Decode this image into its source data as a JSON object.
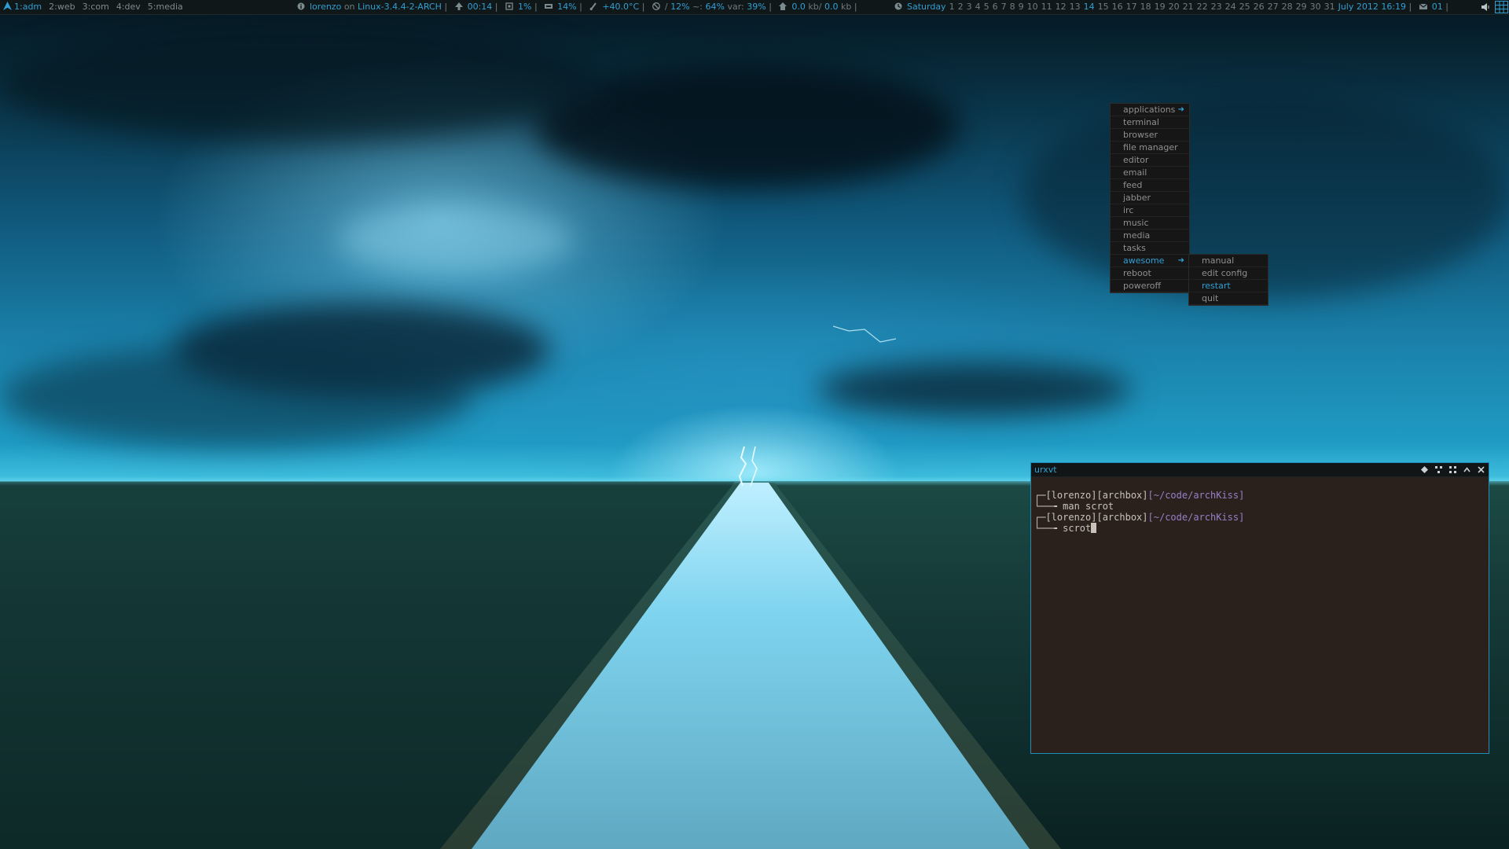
{
  "topbar": {
    "tags": [
      {
        "label": "1:adm",
        "active": true
      },
      {
        "label": "2:web",
        "active": false
      },
      {
        "label": "3:com",
        "active": false
      },
      {
        "label": "4:dev",
        "active": false
      },
      {
        "label": "5:media",
        "active": false
      }
    ],
    "user": "lorenzo",
    "on_word": "on",
    "kernel": "Linux-3.4.4-2-ARCH",
    "uptime": "00:14",
    "cpu": "1%",
    "mem": "14%",
    "temp": "+40.0°C",
    "fs_root_label": "/",
    "fs_root": "12%",
    "fs_home_label": "~:",
    "fs_home": "64%",
    "fs_var_label": "var:",
    "fs_var": "39%",
    "net_down": "0.0",
    "net_down_unit": "kb/",
    "net_up": "0.0",
    "net_up_unit": "kb",
    "weekday": "Saturday",
    "days": [
      "1",
      "2",
      "3",
      "4",
      "5",
      "6",
      "7",
      "8",
      "9",
      "10",
      "11",
      "12",
      "13",
      "14",
      "15",
      "16",
      "17",
      "18",
      "19",
      "20",
      "21",
      "22",
      "23",
      "24",
      "25",
      "26",
      "27",
      "28",
      "29",
      "30",
      "31"
    ],
    "today": "14",
    "month_year_time": "July 2012 16:19",
    "mail_count": "01",
    "icons": {
      "arch": "arch-logo-icon",
      "info": "info-icon",
      "uptime": "uptime-arrow-icon",
      "cpu": "cpu-icon",
      "mem": "memory-icon",
      "temp": "thermometer-icon",
      "fs": "disk-icon",
      "net": "network-icon",
      "clock": "clock-icon",
      "mail": "mail-icon",
      "volume": "volume-icon",
      "layout": "layout-grid-icon"
    }
  },
  "menu": {
    "items": [
      {
        "label": "applications",
        "arrow": "➜"
      },
      {
        "label": "terminal"
      },
      {
        "label": "browser"
      },
      {
        "label": "file manager"
      },
      {
        "label": "editor"
      },
      {
        "label": "email"
      },
      {
        "label": "feed"
      },
      {
        "label": "jabber"
      },
      {
        "label": "irc"
      },
      {
        "label": "music"
      },
      {
        "label": "media"
      },
      {
        "label": "tasks"
      },
      {
        "label": "awesome",
        "arrow": "➜",
        "selected": true
      },
      {
        "label": "reboot"
      },
      {
        "label": "poweroff"
      }
    ],
    "submenu": [
      {
        "label": "manual"
      },
      {
        "label": "edit config"
      },
      {
        "label": "restart",
        "selected": true
      },
      {
        "label": "quit"
      }
    ]
  },
  "terminal": {
    "title": "urxvt",
    "lines": [
      {
        "prefix": "┌─",
        "user": "[lorenzo]",
        "host": "[archbox]",
        "path": "[~/code/archKiss]"
      },
      {
        "prefix": "└──╼ ",
        "command": "man scrot"
      },
      {
        "prefix": "┌─",
        "user": "[lorenzo]",
        "host": "[archbox]",
        "path": "[~/code/archKiss]"
      },
      {
        "prefix": "└──╼ ",
        "command": "scrot"
      }
    ]
  },
  "colors": {
    "accent": "#2f9fd3",
    "bar_bg": "#101719",
    "terminal_bg": "#2a211d",
    "path": "#9a7ec9"
  }
}
